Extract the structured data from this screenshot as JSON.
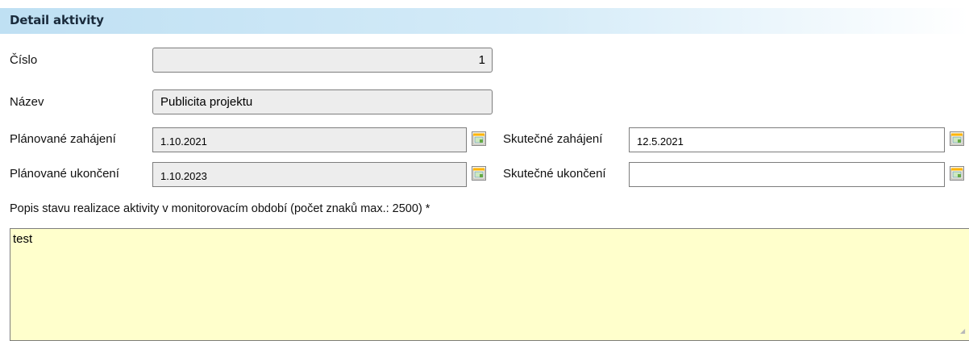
{
  "header": {
    "title": "Detail aktivity"
  },
  "fields": {
    "cislo": {
      "label": "Číslo",
      "value": "1"
    },
    "nazev": {
      "label": "Název",
      "value": "Publicita projektu"
    },
    "planovane_zahajeni": {
      "label": "Plánované zahájení",
      "value": "1.10.2021"
    },
    "skutecne_zahajeni": {
      "label": "Skutečné zahájení",
      "value": "12.5.2021"
    },
    "planovane_ukonceni": {
      "label": "Plánované ukončení",
      "value": "1.10.2023"
    },
    "skutecne_ukonceni": {
      "label": "Skutečné ukončení",
      "value": ""
    }
  },
  "description": {
    "label": "Popis stavu realizace aktivity v monitorovacím období (počet znaků max.: 2500) *",
    "value": "test"
  },
  "icons": {
    "calendar": "calendar-icon"
  },
  "colors": {
    "header_bg": "#bfe0f3",
    "readonly_bg": "#ededed",
    "textarea_bg": "#ffffcc"
  }
}
